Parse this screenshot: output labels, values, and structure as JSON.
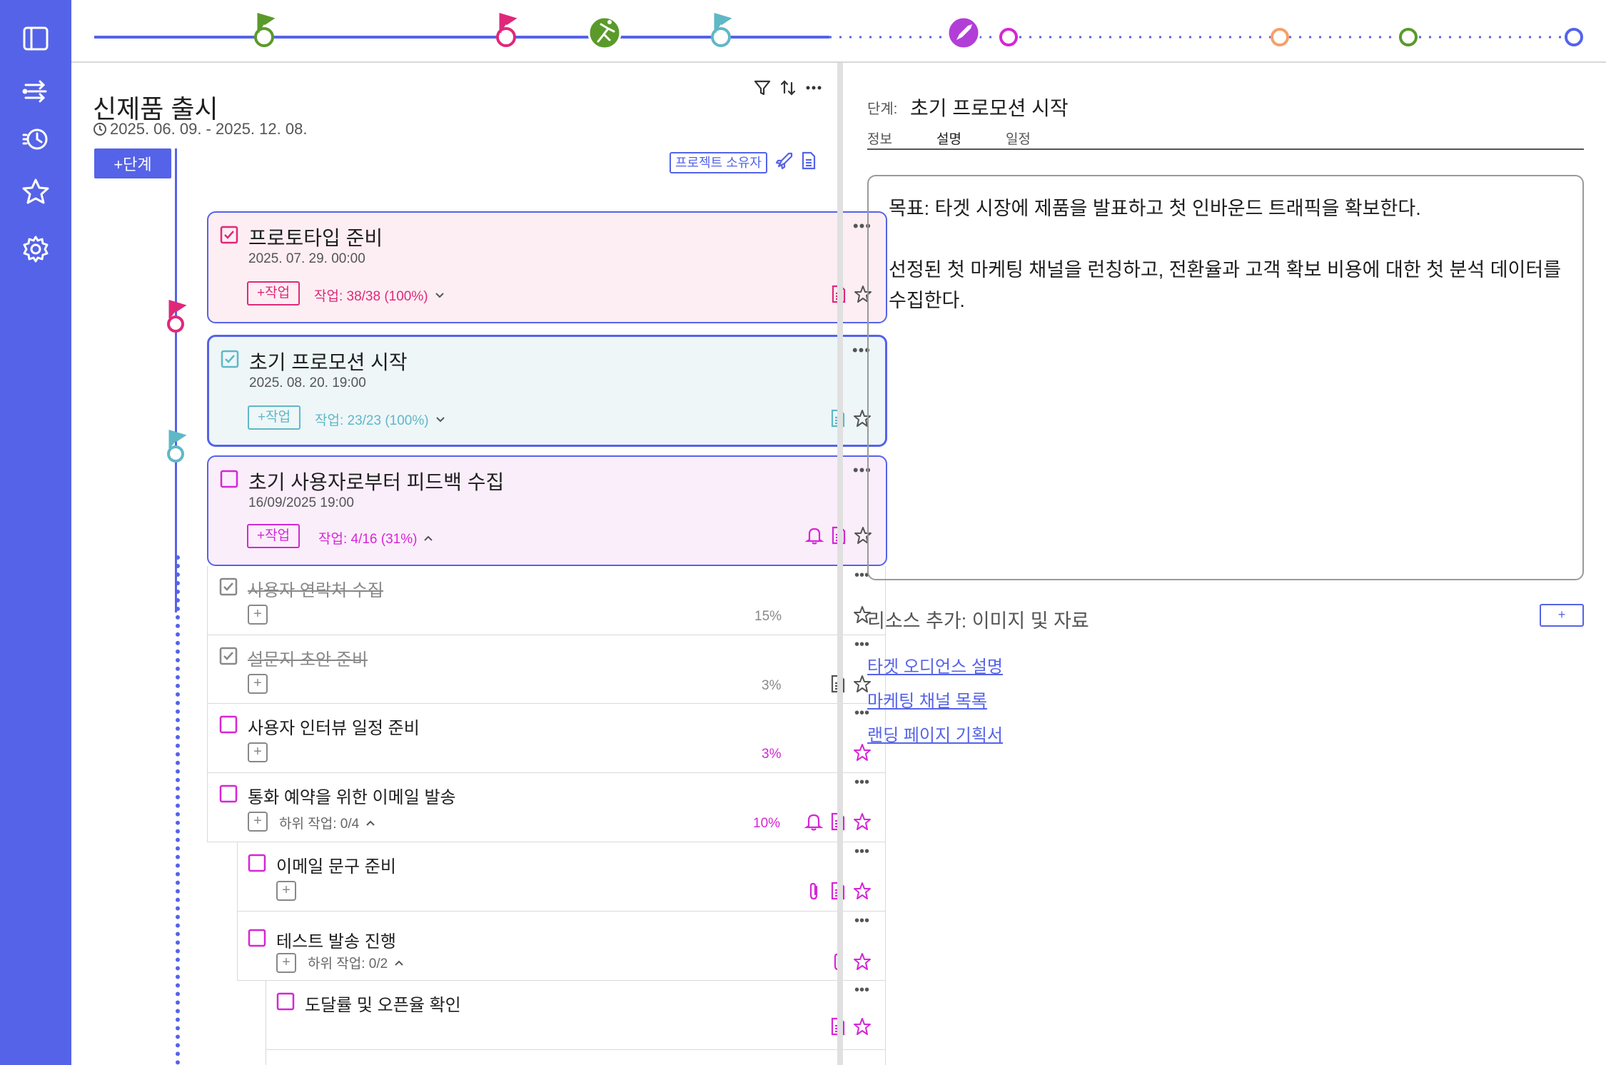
{
  "colors": {
    "accent": "#5563e8",
    "pink": "#e0287a",
    "teal": "#5fb8c6",
    "magenta": "#d526d6",
    "green": "#5a9a2a",
    "purple": "#b23ed8",
    "orange": "#f5a06a"
  },
  "sidebar": {
    "icons": [
      "panel-icon",
      "flow-icon",
      "history-icon",
      "star-icon",
      "gear-icon"
    ]
  },
  "project": {
    "title": "신제품 출시",
    "date_range": "2025. 06. 09. - 2025. 12. 08.",
    "add_stage_label": "+단계",
    "owner_label": "프로젝트 소유자"
  },
  "stages": [
    {
      "title": "프로토타입 준비",
      "date": "2025. 07. 29. 00:00",
      "add_task_label": "+작업",
      "task_count": "작업: 38/38 (100%)"
    },
    {
      "title": "초기 프로모션 시작",
      "date": "2025. 08. 20. 19:00",
      "add_task_label": "+작업",
      "task_count": "작업: 23/23 (100%)"
    },
    {
      "title": "초기 사용자로부터 피드백 수집",
      "date": "16/09/2025 19:00",
      "add_task_label": "+작업",
      "task_count": "작업: 4/16 (31%)"
    }
  ],
  "tasks": [
    {
      "title": "사용자 연락처 수집",
      "percent": "15%",
      "subtasks": ""
    },
    {
      "title": "설문지 초안 준비",
      "percent": "3%",
      "subtasks": ""
    },
    {
      "title": "사용자 인터뷰 일정 준비",
      "percent": "3%",
      "subtasks": ""
    },
    {
      "title": "통화 예약을 위한 이메일 발송",
      "percent": "10%",
      "subtasks": "하위 작업: 0/4"
    },
    {
      "title": "이메일 문구 준비",
      "percent": "",
      "subtasks": ""
    },
    {
      "title": "테스트 발송 진행",
      "percent": "",
      "subtasks": "하위 작업: 0/2"
    },
    {
      "title": "도달률 및 오픈율 확인",
      "percent": "",
      "subtasks": ""
    }
  ],
  "detail": {
    "stage_label": "단계:",
    "stage_name": "초기 프로모션 시작",
    "tabs": [
      "정보",
      "설명",
      "일정"
    ],
    "description": [
      "목표: 타겟 시장에 제품을 발표하고 첫 인바운드 트래픽을 확보한다.",
      "선정된 첫 마케팅 채널을 런칭하고, 전환율과 고객 확보 비용에 대한 첫 분석 데이터를 수집한다."
    ],
    "resources_label": "리소스 추가: 이미지 및 자료",
    "resources_add": "+",
    "resources": [
      "타겟 오디언스 설명",
      "마케팅 채널 목록",
      "랜딩 페이지 기획서"
    ]
  }
}
